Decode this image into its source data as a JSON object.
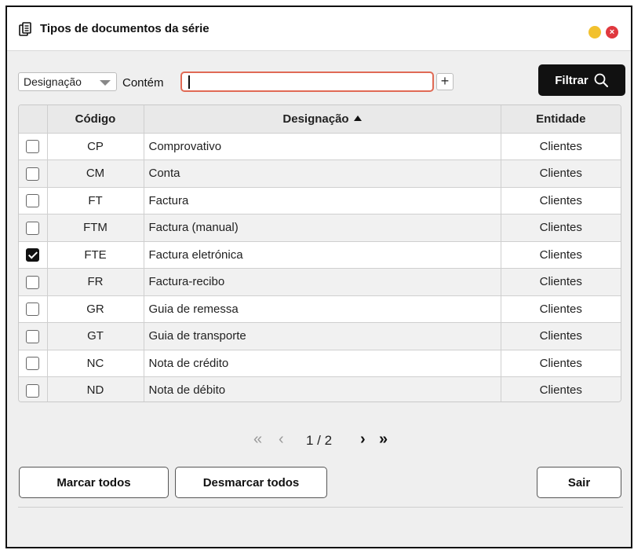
{
  "window": {
    "title": "Tipos de documentos da série",
    "close_symbol": "×"
  },
  "filter": {
    "field_selected": "Designação",
    "condition_label": "Contém",
    "search_value": "",
    "add_label": "+",
    "filter_button_label": "Filtrar"
  },
  "table": {
    "headers": {
      "code": "Código",
      "designation": "Designação",
      "entity": "Entidade"
    },
    "sort": {
      "column": "designation",
      "direction": "ascending"
    },
    "rows": [
      {
        "checked": false,
        "code": "CP",
        "designation": "Comprovativo",
        "entity": "Clientes"
      },
      {
        "checked": false,
        "code": "CM",
        "designation": "Conta",
        "entity": "Clientes"
      },
      {
        "checked": false,
        "code": "FT",
        "designation": "Factura",
        "entity": "Clientes"
      },
      {
        "checked": false,
        "code": "FTM",
        "designation": "Factura (manual)",
        "entity": "Clientes"
      },
      {
        "checked": true,
        "code": "FTE",
        "designation": "Factura eletrónica",
        "entity": "Clientes"
      },
      {
        "checked": false,
        "code": "FR",
        "designation": "Factura-recibo",
        "entity": "Clientes"
      },
      {
        "checked": false,
        "code": "GR",
        "designation": "Guia de remessa",
        "entity": "Clientes"
      },
      {
        "checked": false,
        "code": "GT",
        "designation": "Guia de transporte",
        "entity": "Clientes"
      },
      {
        "checked": false,
        "code": "NC",
        "designation": "Nota de crédito",
        "entity": "Clientes"
      },
      {
        "checked": false,
        "code": "ND",
        "designation": "Nota de débito",
        "entity": "Clientes"
      }
    ]
  },
  "pager": {
    "first_symbol": "«",
    "prev_symbol": "‹",
    "page_info": "1 / 2",
    "next_symbol": "›",
    "last_symbol": "»"
  },
  "actions": {
    "mark_all": "Marcar todos",
    "unmark_all": "Desmarcar todos",
    "exit": "Sair"
  },
  "colors": {
    "accent_dark": "#111111",
    "input_focus_border": "#e06a55",
    "minimize": "#f2c12e",
    "close": "#e0383e"
  }
}
